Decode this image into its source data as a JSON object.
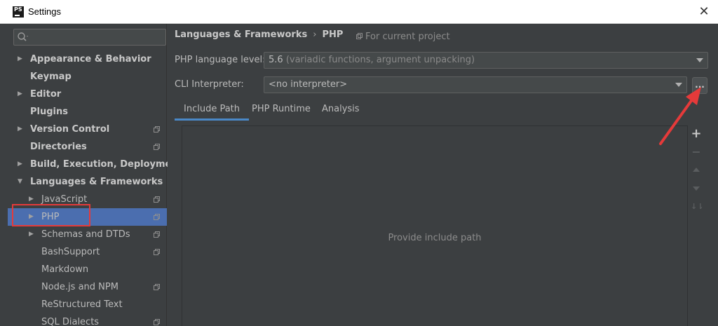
{
  "window": {
    "title": "Settings",
    "icon_text": "PS",
    "close_glyph": "✕"
  },
  "sidebar": {
    "search": {
      "value": "",
      "placeholder": ""
    },
    "items": [
      {
        "label": "Appearance & Behavior",
        "level": 0,
        "expandable": true,
        "expanded": false,
        "project": false
      },
      {
        "label": "Keymap",
        "level": 0,
        "expandable": false,
        "project": false
      },
      {
        "label": "Editor",
        "level": 0,
        "expandable": true,
        "expanded": false,
        "project": false
      },
      {
        "label": "Plugins",
        "level": 0,
        "expandable": false,
        "project": false
      },
      {
        "label": "Version Control",
        "level": 0,
        "expandable": true,
        "expanded": false,
        "project": true
      },
      {
        "label": "Directories",
        "level": 0,
        "expandable": false,
        "project": true
      },
      {
        "label": "Build, Execution, Deployment",
        "level": 0,
        "expandable": true,
        "expanded": false,
        "project": false
      },
      {
        "label": "Languages & Frameworks",
        "level": 0,
        "expandable": true,
        "expanded": true,
        "project": false
      },
      {
        "label": "JavaScript",
        "level": 1,
        "expandable": true,
        "expanded": false,
        "project": true
      },
      {
        "label": "PHP",
        "level": 1,
        "expandable": true,
        "expanded": false,
        "project": true,
        "selected": true
      },
      {
        "label": "Schemas and DTDs",
        "level": 1,
        "expandable": true,
        "expanded": false,
        "project": true
      },
      {
        "label": "BashSupport",
        "level": 1,
        "expandable": false,
        "project": true
      },
      {
        "label": "Markdown",
        "level": 1,
        "expandable": false,
        "project": false
      },
      {
        "label": "Node.js and NPM",
        "level": 1,
        "expandable": false,
        "project": true
      },
      {
        "label": "ReStructured Text",
        "level": 1,
        "expandable": false,
        "project": false
      },
      {
        "label": "SQL Dialects",
        "level": 1,
        "expandable": false,
        "project": true
      }
    ]
  },
  "main": {
    "breadcrumb": [
      "Languages & Frameworks",
      "PHP"
    ],
    "breadcrumb_separator": "›",
    "for_current_project": "For current project",
    "php_language_level": {
      "label": "PHP language level:",
      "version": "5.6",
      "description": "(variadic functions, argument unpacking)"
    },
    "cli_interpreter": {
      "label": "CLI Interpreter:",
      "value": "<no interpreter>",
      "browse_label": "..."
    },
    "tabs": [
      {
        "label": "Include Path",
        "active": true
      },
      {
        "label": "PHP Runtime",
        "active": false
      },
      {
        "label": "Analysis",
        "active": false
      }
    ],
    "include_path": {
      "empty_text": "Provide include path",
      "tools": [
        {
          "icon": "plus-icon",
          "glyph": "+",
          "enabled": true
        },
        {
          "icon": "minus-icon",
          "glyph": "−",
          "enabled": false
        },
        {
          "icon": "move-up-icon",
          "glyph": "",
          "enabled": false
        },
        {
          "icon": "move-down-icon",
          "glyph": "",
          "enabled": false
        },
        {
          "icon": "sort-icon",
          "glyph": "↓⇂",
          "enabled": false
        }
      ]
    }
  },
  "colors": {
    "background": "#3c3f41",
    "selection": "#4b6eaf",
    "tab_underline": "#4a88c7",
    "annotation_red": "#e53a3a"
  }
}
